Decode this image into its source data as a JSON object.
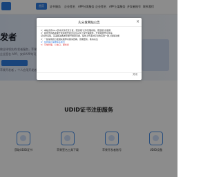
{
  "nav": {
    "logo_text": "",
    "items": [
      {
        "label": "首页",
        "active": true
      },
      {
        "label": "证书服务",
        "active": false
      },
      {
        "label": "企业签名",
        "active": false
      },
      {
        "label": "APP分发服务",
        "active": false
      },
      {
        "label": "企业签名",
        "active": false
      },
      {
        "label": "APP上架服务",
        "active": false
      },
      {
        "label": "开发者账号",
        "active": false
      },
      {
        "label": "联系我们",
        "active": false
      }
    ]
  },
  "hero": {
    "title": "i发者",
    "line1": "做全球领先的i发者服务，苹果开发者账",
    "line2": "企业签名 APP、安卓APP均可上架",
    "line3": "苹果开发者 ，个人应用开发者也可以"
  },
  "section": {
    "title": "UDID证书注册服务"
  },
  "cards": [
    {
      "label": "获取UDID证书"
    },
    {
      "label": "苹果签名工具下载"
    },
    {
      "label": "苹果开发者账号"
    },
    {
      "label": "UDID设备"
    }
  ],
  "modal": {
    "title": "久分发网站公告",
    "close": "×",
    "lines": [
      {
        "text": "1：本站支持ios+安卓文件托管分发，赠送相\"文件管理系统，赠送相\"的使用",
        "style": ""
      },
      {
        "text": "2：我司支持各苹果开发者账号的企业及APP上架代理服务，开发者账号可申请",
        "style": ""
      },
      {
        "text": "证书申请等，完美解决各类苹果开发者问题，提供上传多种平台的应用一键上架等功能",
        "style": ""
      },
      {
        "text": "3：一些常用的分发相关推荐内容请查看，定期更新，敬请关注",
        "style": ""
      },
      {
        "text": "4：在线客户需要联系我们",
        "style": "blue"
      },
      {
        "text": "5：可信管理，公信口，服务商",
        "style": "red"
      }
    ],
    "ok": "关闭"
  }
}
